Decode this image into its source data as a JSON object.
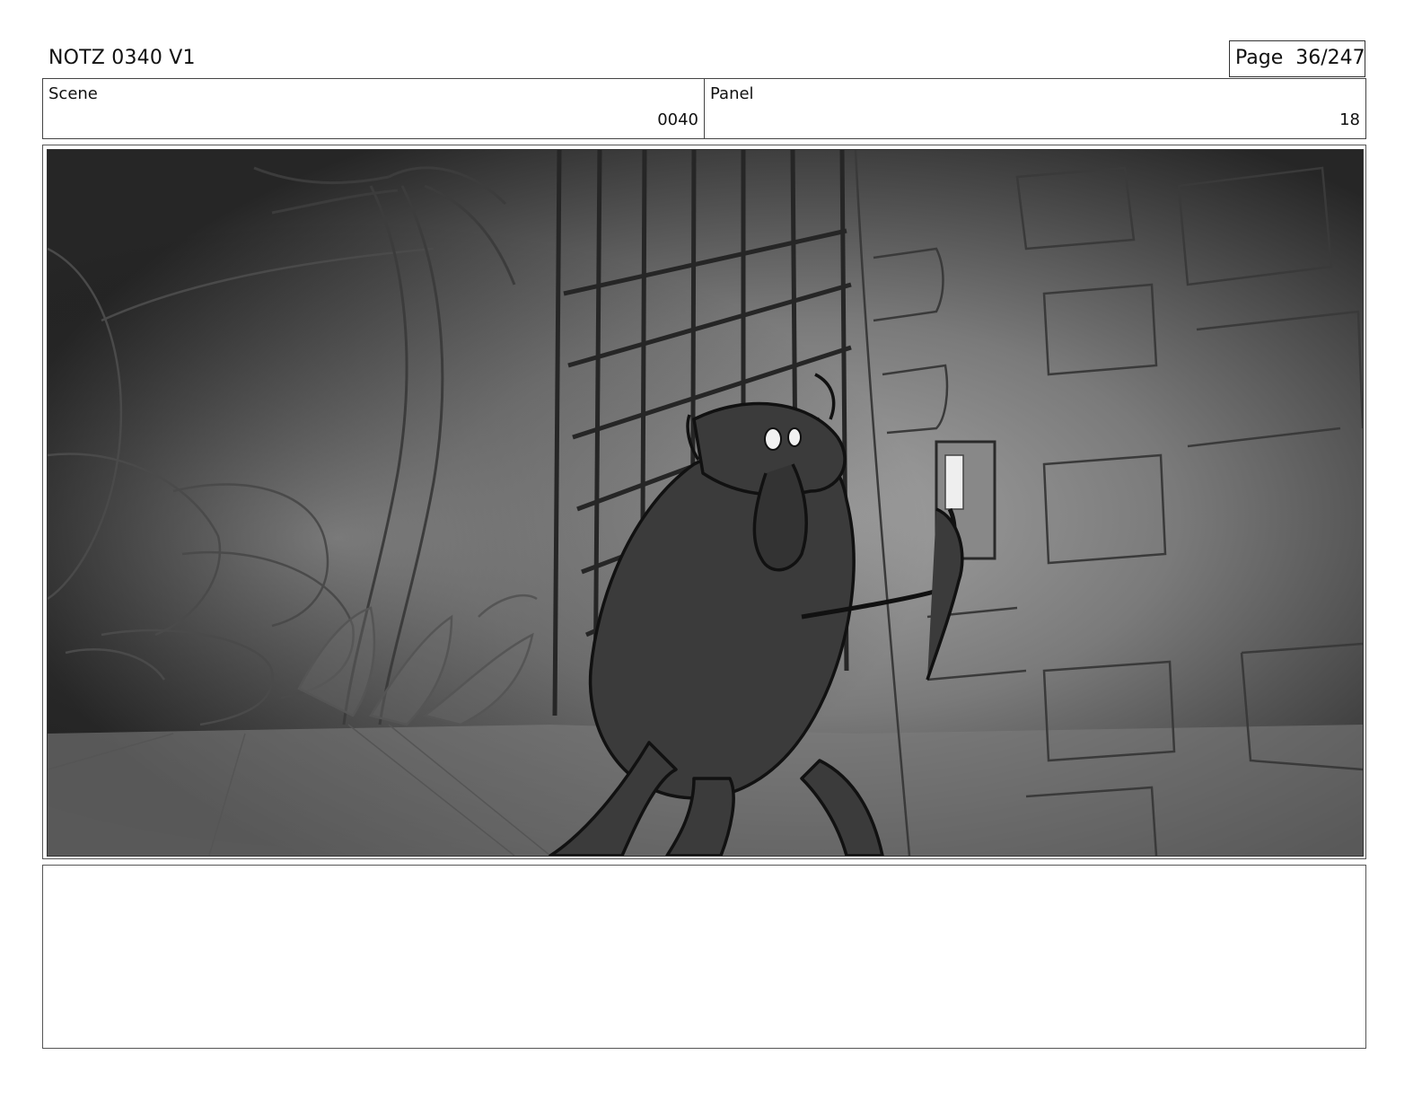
{
  "header": {
    "title": "NOTZ 0340 V1",
    "page_label": "Page",
    "page_number": "36/247"
  },
  "info": {
    "scene_label": "Scene",
    "scene_value": "0040",
    "panel_label": "Panel",
    "panel_value": "18"
  },
  "colors": {
    "border": "#444444",
    "sketch_dark": "#222222",
    "sketch_mid": "#6b6b6b",
    "sketch_light": "#9a9a9a"
  },
  "notes": ""
}
